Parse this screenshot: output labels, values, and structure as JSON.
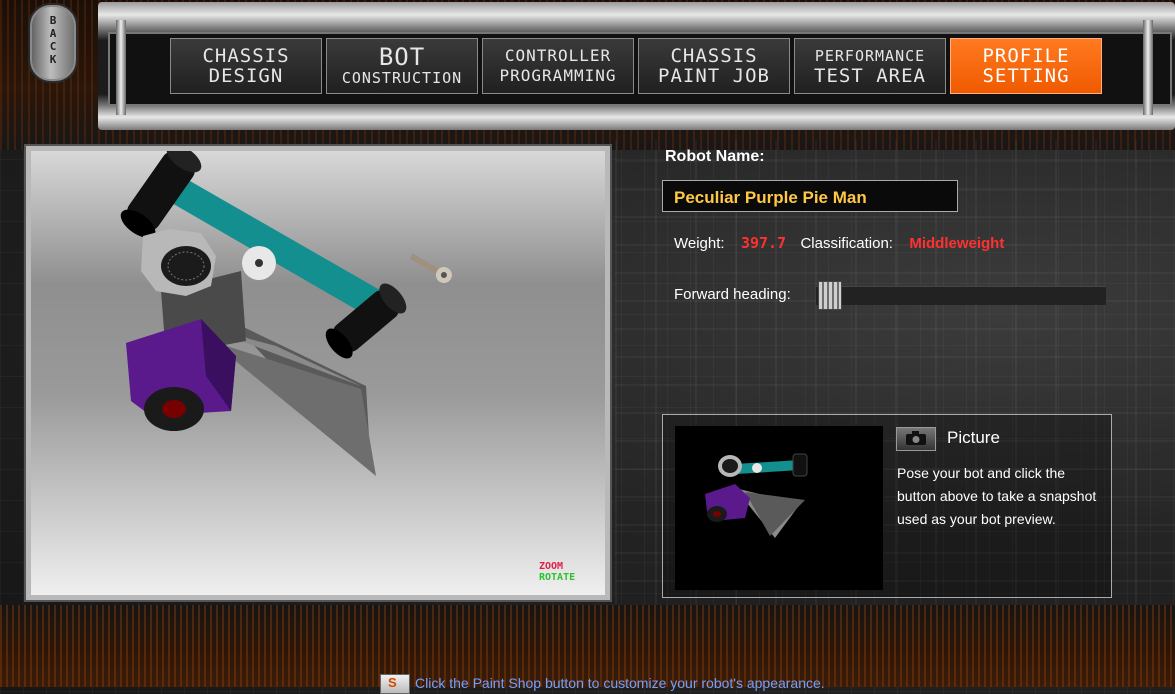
{
  "back_label": "BACK",
  "nav": {
    "tabs": [
      {
        "line1": "CHASSIS",
        "line2": "DESIGN"
      },
      {
        "line1": "BOT",
        "line2": "CONSTRUCTION"
      },
      {
        "line1": "CONTROLLER",
        "line2": "PROGRAMMING"
      },
      {
        "line1": "CHASSIS",
        "line2": "PAINT JOB"
      },
      {
        "line1": "PERFORMANCE",
        "line2": "TEST AREA"
      },
      {
        "line1": "PROFILE",
        "line2": "SETTING"
      }
    ],
    "active_tab": 5,
    "active_color": "#f5640a"
  },
  "viewport": {
    "zoom_label": "ZOOM",
    "rotate_label": "ROTATE"
  },
  "profile": {
    "robot_name_label": "Robot Name:",
    "robot_name": "Peculiar Purple Pie Man",
    "weight_label": "Weight:",
    "weight_value": "397.7",
    "classification_label": "Classification:",
    "classification_value": "Middleweight",
    "forward_heading_label": "Forward heading:",
    "forward_heading_value": 0.0
  },
  "picture": {
    "title": "Picture",
    "description": "Pose your bot and click the button above to take a snapshot used as your bot preview.",
    "camera_icon": "camera-icon"
  },
  "hint": {
    "icon": "paint-shop-icon",
    "text": "Click the Paint Shop button to customize your robot's appearance."
  },
  "colors": {
    "accent_orange": "#f5640a",
    "name_gold": "#ffc845",
    "stat_red": "#ff3030",
    "link_blue": "#6fa0ff",
    "bot_purple": "#5a1a8c",
    "bot_teal": "#138f8f"
  }
}
